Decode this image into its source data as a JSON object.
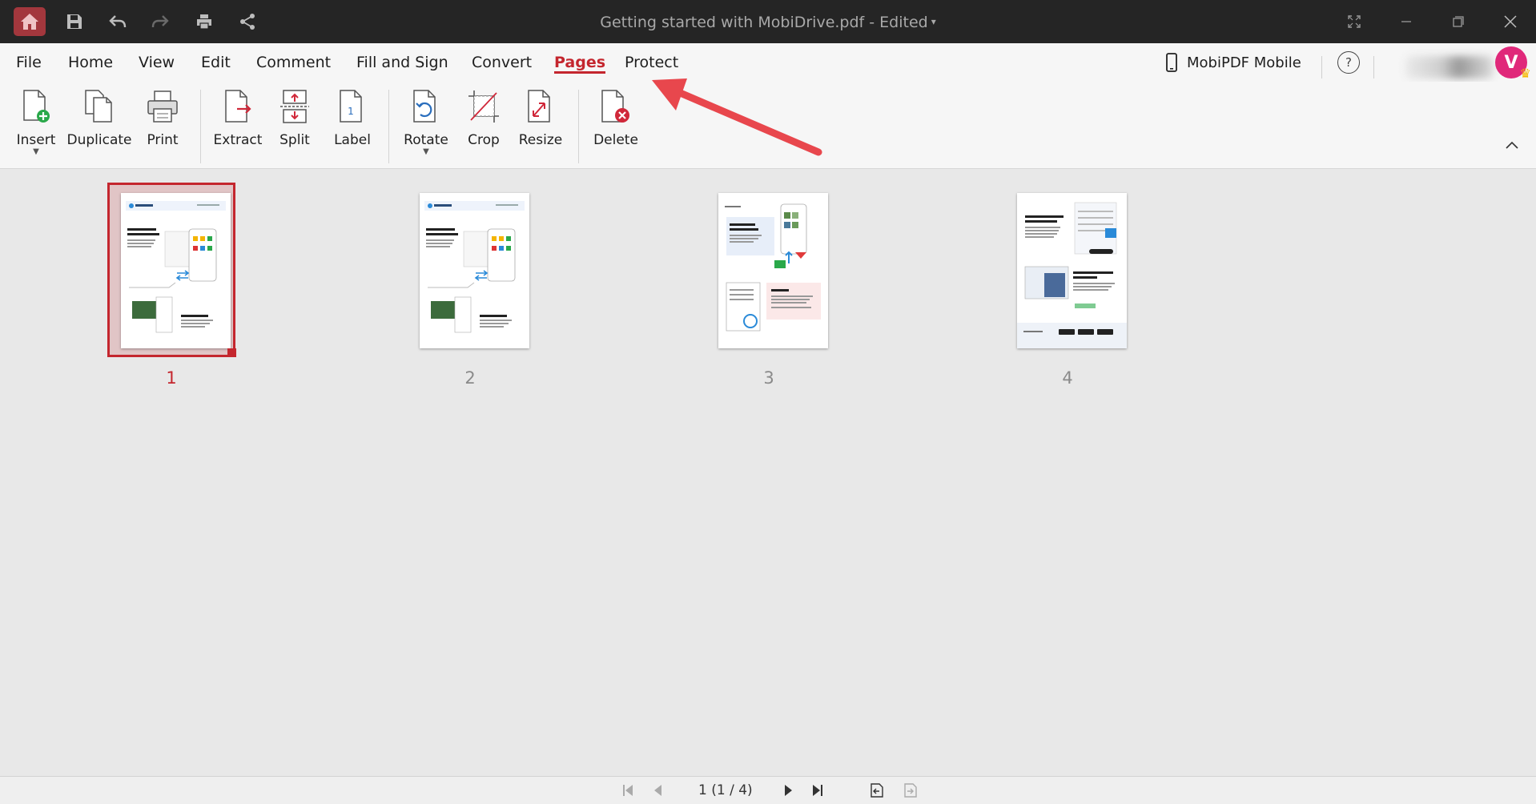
{
  "window": {
    "title": "Getting started with MobiDrive.pdf - Edited",
    "title_caret": "▾"
  },
  "menu": {
    "items": [
      "File",
      "Home",
      "View",
      "Edit",
      "Comment",
      "Fill and Sign",
      "Convert",
      "Pages",
      "Protect"
    ],
    "active": "Pages",
    "mobile_label": "MobiPDF Mobile",
    "help_label": "?",
    "avatar_letter": "V"
  },
  "ribbon": {
    "tools": [
      {
        "label": "Insert",
        "icon": "insert-page-icon",
        "dropdown": true
      },
      {
        "label": "Duplicate",
        "icon": "duplicate-page-icon"
      },
      {
        "label": "Print",
        "icon": "print-icon"
      },
      {
        "label": "Extract",
        "icon": "extract-page-icon"
      },
      {
        "label": "Split",
        "icon": "split-page-icon"
      },
      {
        "label": "Label",
        "icon": "label-page-icon"
      },
      {
        "label": "Rotate",
        "icon": "rotate-page-icon",
        "dropdown": true
      },
      {
        "label": "Crop",
        "icon": "crop-page-icon"
      },
      {
        "label": "Resize",
        "icon": "resize-page-icon"
      },
      {
        "label": "Delete",
        "icon": "delete-page-icon"
      }
    ]
  },
  "pages": {
    "thumbnails": [
      {
        "number": "1",
        "selected": true
      },
      {
        "number": "2",
        "selected": false
      },
      {
        "number": "3",
        "selected": false
      },
      {
        "number": "4",
        "selected": false
      }
    ]
  },
  "status": {
    "page_indicator": "1 (1 / 4)"
  },
  "colors": {
    "accent": "#c4262e",
    "titlebar": "#252525",
    "annotation": "#e8474d"
  }
}
